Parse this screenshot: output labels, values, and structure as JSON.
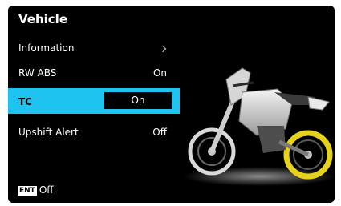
{
  "header": {
    "title": "Vehicle"
  },
  "menu": [
    {
      "label": "Information",
      "value": ""
    },
    {
      "label": "RW ABS",
      "value": "On"
    },
    {
      "label": "TC",
      "value": "On"
    },
    {
      "label": "Upshift Alert",
      "value": "Off"
    }
  ],
  "footer": {
    "key": "ENT",
    "text": "Off"
  },
  "colors": {
    "highlight": "#1fc3ef",
    "wheel_accent": "#e6d21a"
  },
  "icons": {
    "information": "chevron-right-icon"
  }
}
